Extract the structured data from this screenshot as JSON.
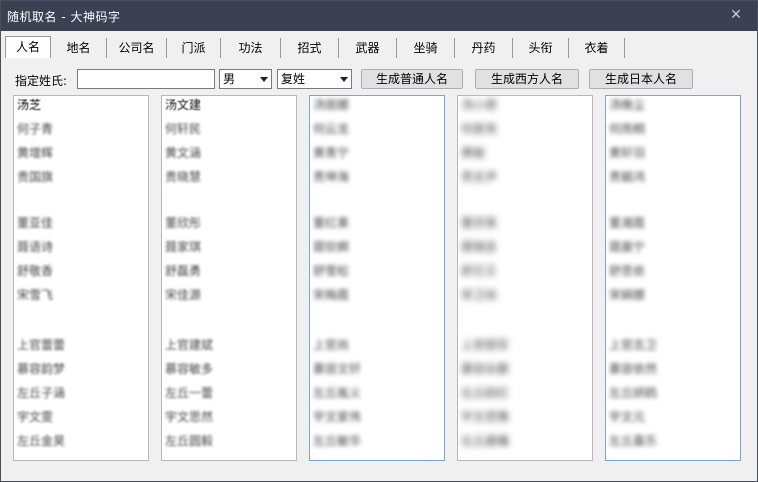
{
  "window": {
    "title": "随机取名 - 大神码字",
    "close_glyph": "✕"
  },
  "tabs": [
    {
      "label": "人名",
      "active": true
    },
    {
      "label": "地名"
    },
    {
      "label": "公司名"
    },
    {
      "label": "门派"
    },
    {
      "label": "功法"
    },
    {
      "label": "招式"
    },
    {
      "label": "武器"
    },
    {
      "label": "坐骑"
    },
    {
      "label": "丹药"
    },
    {
      "label": "头衔"
    },
    {
      "label": "衣着"
    }
  ],
  "controls": {
    "surname_label": "指定姓氏:",
    "surname_value": "",
    "gender_value": "男",
    "surname_type_value": "复姓",
    "btn_normal": "生成普通人名",
    "btn_western": "生成西方人名",
    "btn_japanese": "生成日本人名"
  },
  "lists": [
    [
      "汤芝",
      "何子青",
      "黄增辉",
      "贵国旗",
      "董亚佳",
      "聂语诗",
      "舒敬香",
      "宋雪飞",
      "上官蕾蕾",
      "慕容韵梦",
      "左丘子涵",
      "宇文雯",
      "左丘金昊"
    ],
    [
      "汤文建",
      "何轩民",
      "黄文涵",
      "贵晓慧",
      "董欣彤",
      "聂家琪",
      "舒磊勇",
      "宋佳源",
      "上官建斌",
      "慕容敏多",
      "左丘一蕾",
      "宇文思然",
      "左丘圆毅"
    ],
    [
      "汤丽娜",
      "何云龙",
      "黄青宁",
      "贵坤海",
      "董红果",
      "聂钦婀",
      "舒雪松",
      "宋梅霞",
      "上官尚",
      "慕容文钎",
      "左丘胤义",
      "宇文家伟",
      "左丘敏华"
    ],
    [
      "汤小君",
      "何家亮",
      "黄榆",
      "贵言尹",
      "董宗英",
      "聂锦丞",
      "舒芯王",
      "宋卫尚",
      "上官丽军",
      "慕容永鹏",
      "左丘韵红",
      "宇文思豫",
      "左丘晨曦"
    ],
    [
      "汤晚尘",
      "何雨桐",
      "黄轩羽",
      "贵毓鸿",
      "董湘霞",
      "聂晨宁",
      "舒思依",
      "宋娴娜",
      "上官志卫",
      "慕容依然",
      "左丘妍鸥",
      "宇文元",
      "左丘嘉乐"
    ]
  ]
}
